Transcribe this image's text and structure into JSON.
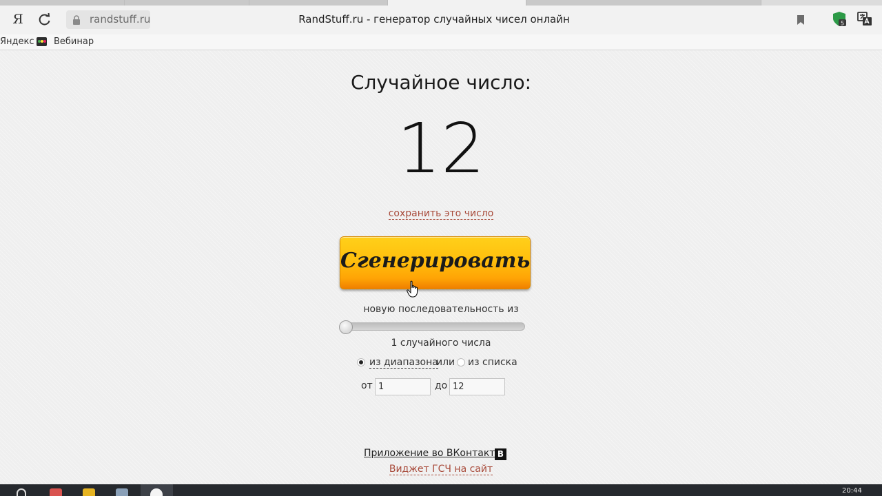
{
  "browser": {
    "url": "randstuff.ru",
    "title": "RandStuff.ru - генератор случайных чисел онлайн",
    "yandex_button": "Я",
    "extension_badge": "5"
  },
  "bookmarks": [
    "Яндекс",
    "Вебинар"
  ],
  "page": {
    "heading": "Случайное число:",
    "number": "12",
    "save_link": "сохранить это число",
    "generate_button": "Сгенерировать",
    "sequence_label": "новую последовательность из",
    "slider_value": 1,
    "count_label": "1 случайного числа",
    "range_radio_label": "из диапазона",
    "or_text": "или",
    "list_radio_label": "из списка",
    "selected_mode": "range",
    "from_label": "от",
    "from_value": "1",
    "to_label": "до",
    "to_value": "12",
    "vk_app_link": "Приложение во ВКонтакте",
    "vk_icon_letter": "В",
    "widget_link": "Виджет ГСЧ на сайт"
  },
  "taskbar": {
    "clock": "20:44"
  },
  "colors": {
    "link_red": "#a84a3a",
    "button_orange": "#ffbf0d"
  }
}
